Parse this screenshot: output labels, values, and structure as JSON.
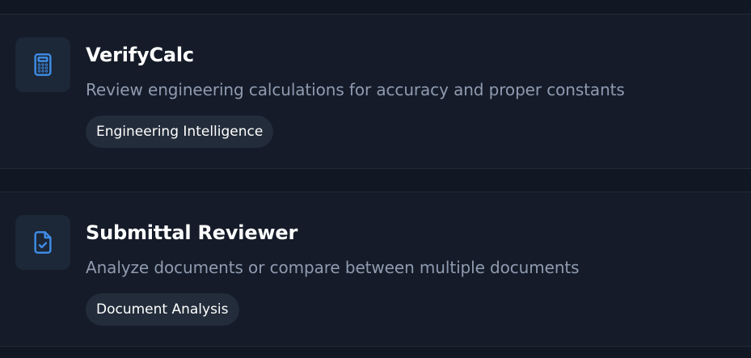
{
  "tools": [
    {
      "name": "VerifyCalc",
      "description": "Review engineering calculations for accuracy and proper constants",
      "tag": "Engineering Intelligence",
      "icon": "calculator-icon"
    },
    {
      "name": "Submittal Reviewer",
      "description": "Analyze documents or compare between multiple documents",
      "tag": "Document Analysis",
      "icon": "document-check-icon"
    }
  ],
  "colors": {
    "background": "#111723",
    "card": "#151b28",
    "icon_tile": "#1c2737",
    "icon_accent": "#3f8ee8",
    "tag_bg": "#232c3a"
  }
}
